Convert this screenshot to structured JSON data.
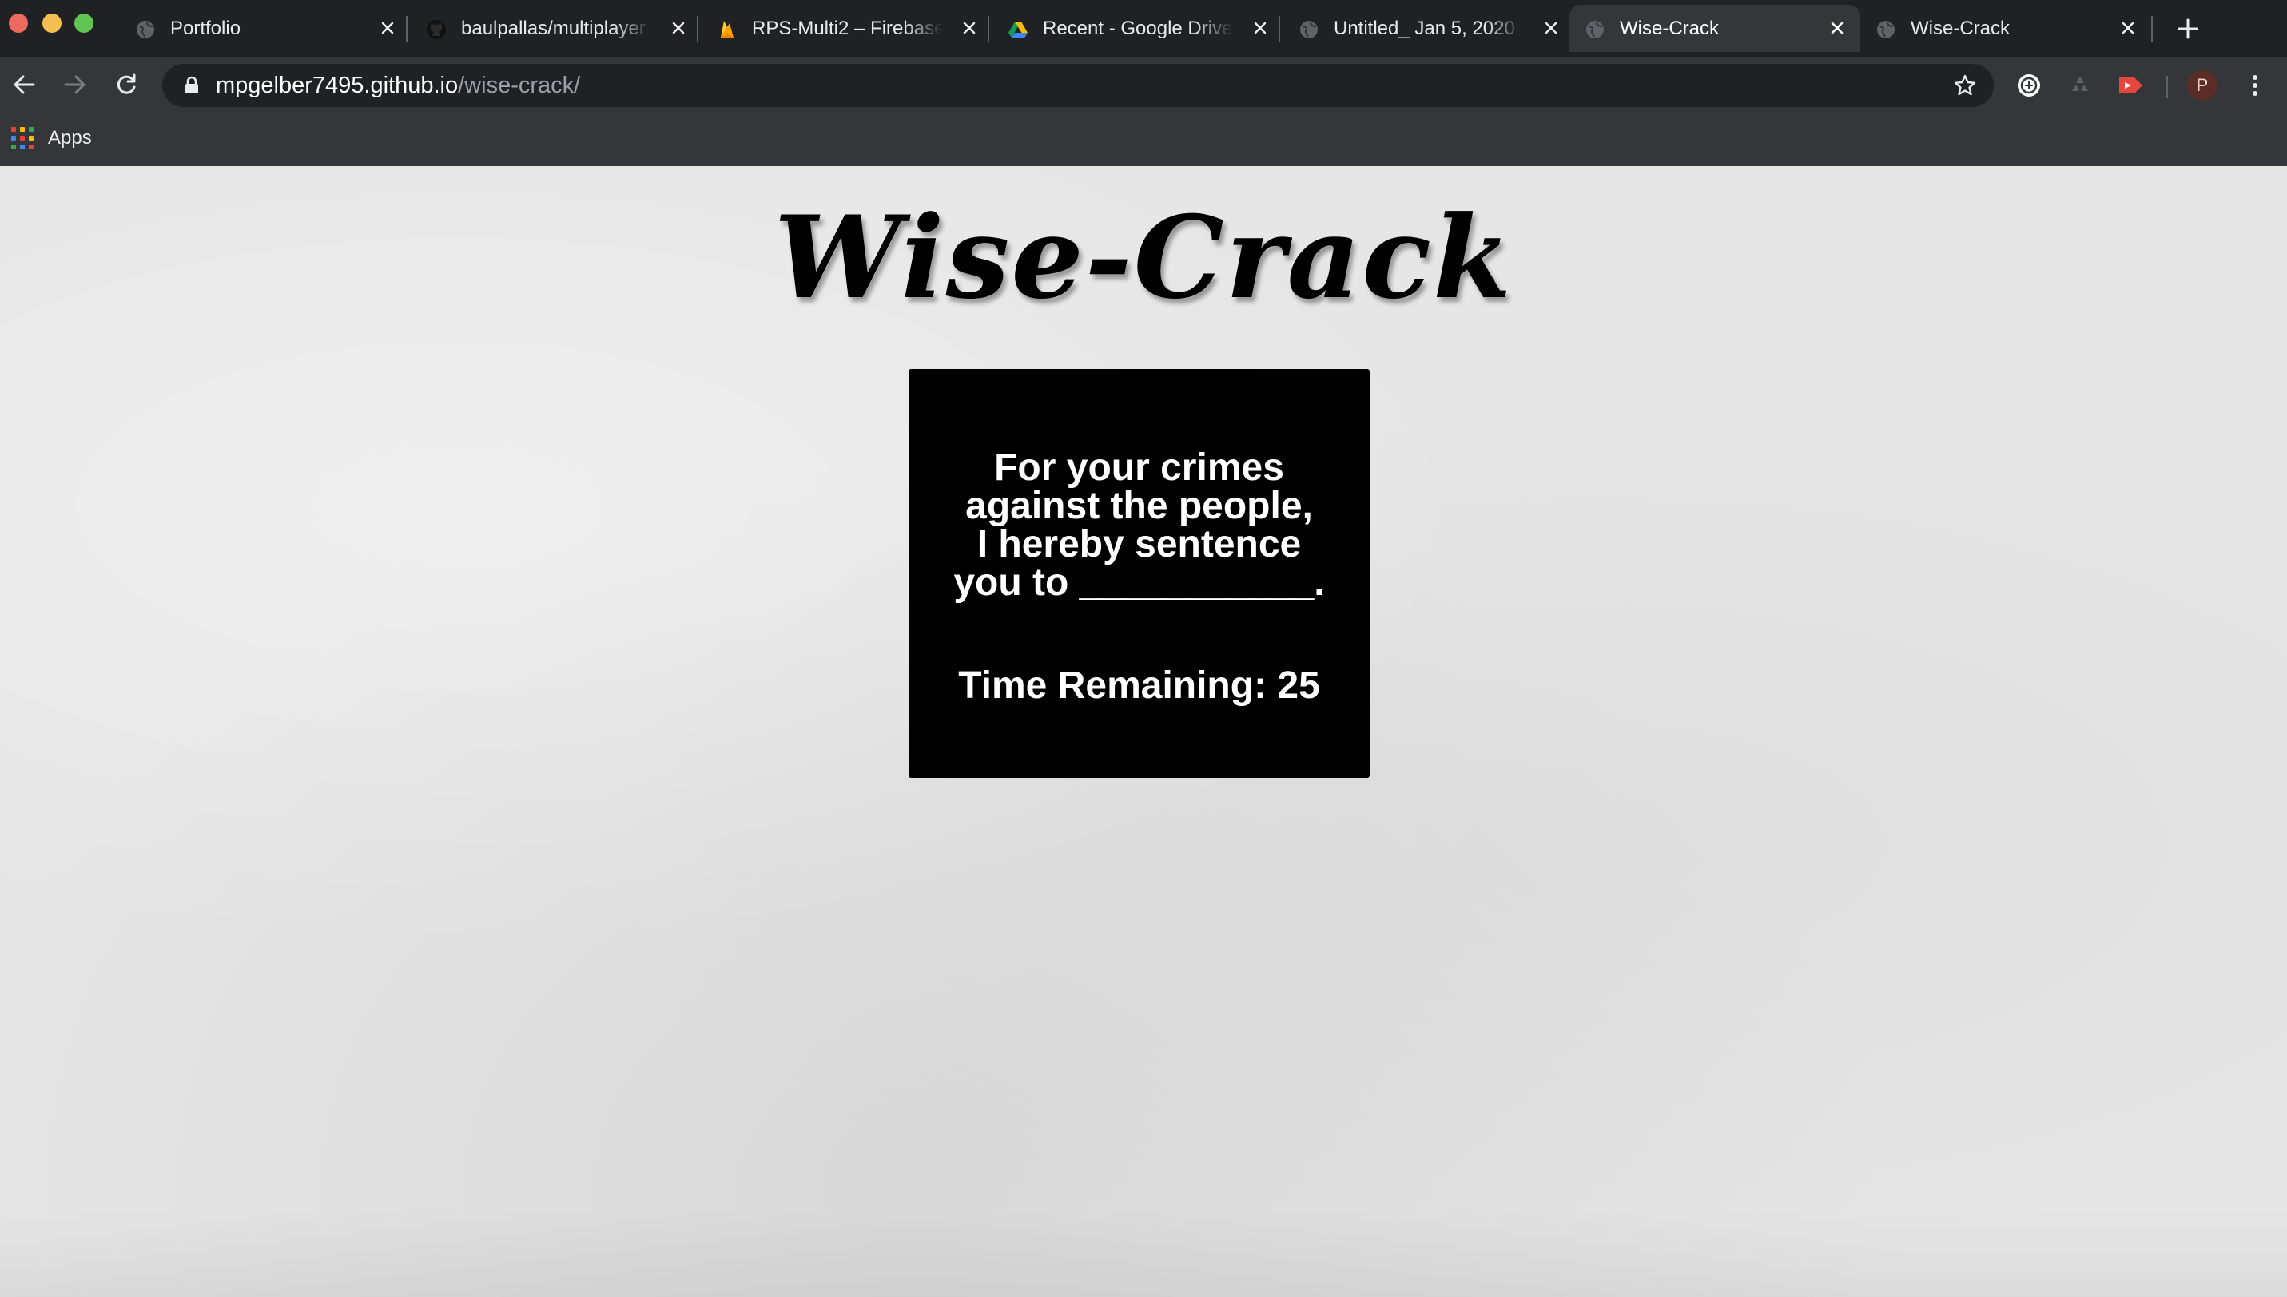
{
  "browser": {
    "tabs": [
      {
        "label": "Portfolio",
        "favicon": "globe-icon",
        "active": false
      },
      {
        "label": "baulpallas/multiplayer",
        "favicon": "github-icon",
        "active": false
      },
      {
        "label": "RPS-Multi2 – Firebase",
        "favicon": "firebase-icon",
        "active": false
      },
      {
        "label": "Recent - Google Drive",
        "favicon": "google-drive-icon",
        "active": false
      },
      {
        "label": "Untitled_ Jan 5, 2020",
        "favicon": "globe-icon",
        "active": false
      },
      {
        "label": "Wise-Crack",
        "favicon": "globe-icon",
        "active": true
      },
      {
        "label": "Wise-Crack",
        "favicon": "globe-icon",
        "active": false
      }
    ],
    "address_bar": {
      "host": "mpgelber7495.github.io",
      "path": "/wise-crack/"
    },
    "profile_initial": "P",
    "bookmarks": {
      "apps_label": "Apps"
    },
    "colors": {
      "chrome_dark": "#202124",
      "chrome_toolbar": "#35363a"
    }
  },
  "page": {
    "title": "Wise-Crack",
    "prompt": {
      "line1": "For your crimes",
      "line2": "against the people,",
      "line3": "I hereby sentence",
      "line4": "you to ___________."
    },
    "timer": {
      "label": "Time Remaining:",
      "value": "25"
    },
    "colors": {
      "background": "#e6e6e6",
      "card": "#000000",
      "card_text": "#ffffff"
    }
  }
}
